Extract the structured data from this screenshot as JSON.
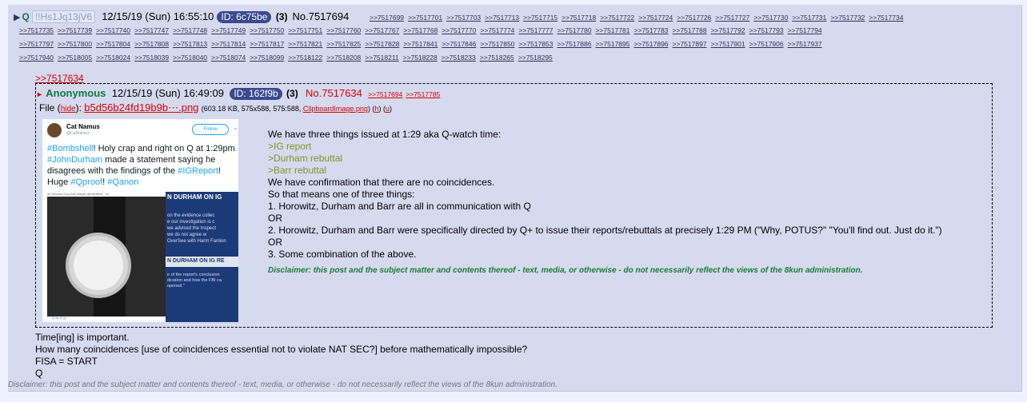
{
  "post": {
    "arrow": "▶",
    "name": "Q",
    "trip": "!!Hs1Jq13jV6",
    "date": "12/15/19 (Sun) 16:55:10",
    "id_label": "ID: 6c75be",
    "count": "(3)",
    "number": "No.7517694",
    "mentions_row1": [
      ">>7517699",
      ">>7517701",
      ">>7517703",
      ">>7517713",
      ">>7517715",
      ">>7517718",
      ">>7517722",
      ">>7517724",
      ">>7517726",
      ">>7517727",
      ">>7517730",
      ">>7517731",
      ">>7517732",
      ">>7517734"
    ],
    "mentions_row2": [
      ">>7517735",
      ">>7517739",
      ">>7517740",
      ">>7517747",
      ">>7517748",
      ">>7517749",
      ">>7517750",
      ">>7517751",
      ">>7517760",
      ">>7517767",
      ">>7517768",
      ">>7517770",
      ">>7517774",
      ">>7517777",
      ">>7517780",
      ">>7517781",
      ">>7517783",
      ">>7517788",
      ">>7517792",
      ">>7517793",
      ">>7517794"
    ],
    "mentions_row3": [
      ">>7517797",
      ">>7517800",
      ">>7517804",
      ">>7517808",
      ">>7517813",
      ">>7517814",
      ">>7517817",
      ">>7517821",
      ">>7517825",
      ">>7517828",
      ">>7517841",
      ">>7517846",
      ">>7517850",
      ">>7517853",
      ">>7517886",
      ">>7517895",
      ">>7517896",
      ">>7517897",
      ">>7517901",
      ">>7517906",
      ">>7517937"
    ],
    "mentions_row4": [
      ">>7517940",
      ">>7518005",
      ">>7518024",
      ">>7518039",
      ">>7518040",
      ">>7518074",
      ">>7518099",
      ">>7518122",
      ">>7518208",
      ">>7518211",
      ">>7518228",
      ">>7518233",
      ">>7518265",
      ">>7518295"
    ],
    "quote_link": ">>7517634",
    "after_lines": [
      "Time[ing] is important.",
      "How many coincidences [use of coincidences essential not to violate NAT SEC?] before mathematically impossible?",
      "FISA = START",
      "Q"
    ],
    "disclaimer": "Disclaimer: this post and the subject matter and contents thereof - text, media, or otherwise - do not necessarily reflect the views of the 8kun administration."
  },
  "inline": {
    "name": "Anonymous",
    "date": "12/15/19 (Sun) 16:49:09",
    "id_label": "ID: 162f9b",
    "count": "(3)",
    "number": "No.7517634",
    "mentions": [
      ">>7517694",
      ">>7517785"
    ],
    "file_label": "File",
    "hide": "hide",
    "filename": "b5d56b24fd19b9b⋯.png",
    "file_meta": "(603.18 KB, 575x588, 575:588,",
    "file_orig": "ClipboardImage.png",
    "file_h": "h",
    "file_u": "u",
    "body": [
      {
        "t": "We have three things issued at 1:29 aka Q-watch time:",
        "g": false
      },
      {
        "t": ">IG report",
        "g": true
      },
      {
        "t": ">Durham rebuttal",
        "g": true
      },
      {
        "t": ">Barr rebuttal",
        "g": true
      },
      {
        "t": "We have confirmation that there are no coincidences.",
        "g": false
      },
      {
        "t": "So that means one of three things:",
        "g": false
      },
      {
        "t": "1. Horowitz, Durham and Barr are all in communication with Q",
        "g": false
      },
      {
        "t": "OR",
        "g": false
      },
      {
        "t": "2. Horowitz, Durham and Barr were specifically directed by Q+ to issue their reports/rebuttals at precisely 1:29 PM (\"Why, POTUS?\"  \"You'll find out. Just do it.\")",
        "g": false
      },
      {
        "t": "OR",
        "g": false
      },
      {
        "t": "3. Some combination of the above.",
        "g": false
      }
    ],
    "disclaimer": "Disclaimer: this post and the subject matter and contents thereof - text, media, or otherwise - do not necessarily reflect the views of the 8kun administration."
  },
  "thumb": {
    "tw_name": "Cat Namus",
    "tw_handle": "@CatNamus",
    "follow": "Follow",
    "caret": "⌄",
    "tweet_parts": [
      {
        "t": "#Bombshell",
        "tag": true
      },
      {
        "t": "! Holy crap and right on Q at 1:29pm ",
        "tag": false
      },
      {
        "t": "#JohnDurham",
        "tag": true
      },
      {
        "t": " made a statement saying he disagrees with the findings of the ",
        "tag": false
      },
      {
        "t": "#IGReport",
        "tag": true
      },
      {
        "t": "! Huge ",
        "tag": false
      },
      {
        "t": "#Qproof",
        "tag": true
      },
      {
        "t": "! ",
        "tag": false
      },
      {
        "t": "#Qanon",
        "tag": true
      }
    ],
    "small_line": "30 Second Guy Dan Weyer @HaHaHa · 1h",
    "screen_head": "N DURHAM ON IG",
    "screen_lines": "on the evidence collec\ne our investigation is c\nwe advised the Inspect\nwe do not agree w\nOverSee with Harm Fanlion",
    "screen_head2": "N DURHAM ON IG RE",
    "screen_lines2": "e of the report's conclusion\ndication and how the FBI ca\nopened.\"",
    "tw_foot": "♡ 4    ⇆ 4    ✉"
  },
  "colors": {
    "name": "#117743",
    "link": "#34345c",
    "quote": "#d00",
    "greentext": "#789922",
    "post_bg": "#d6daf0",
    "page_bg": "#eef2ff",
    "id_bg": "#3b4a8f"
  }
}
